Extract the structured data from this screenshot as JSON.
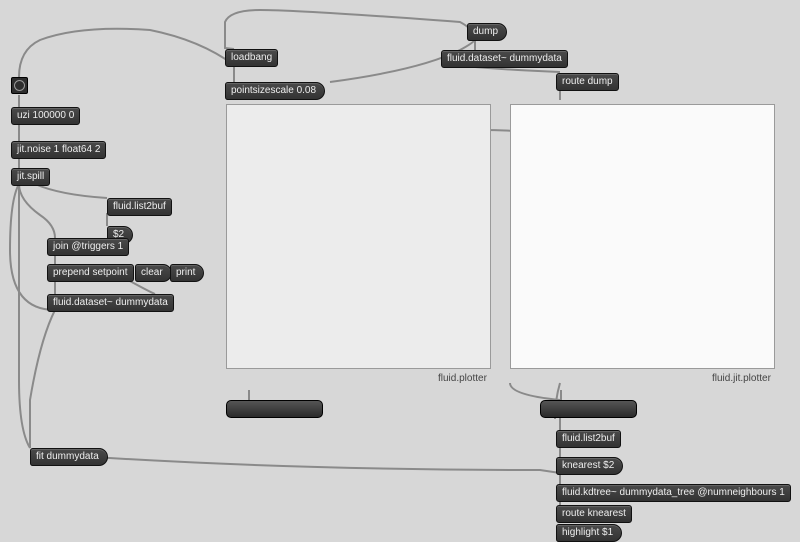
{
  "objects": {
    "uzi": "uzi 100000 0",
    "jitnoise": "jit.noise 1 float64 2",
    "jitspill": "jit.spill",
    "list2buf1": "fluid.list2buf",
    "dollar2a": "$2",
    "join": "join @triggers 1",
    "prepend": "prepend setpoint",
    "clear": "clear",
    "print": "print",
    "dataset1": "fluid.dataset~ dummydata",
    "fitdummy": "fit dummydata",
    "loadbang": "loadbang",
    "pointsize": "pointsizescale 0.08",
    "dump": "dump",
    "dataset2": "fluid.dataset~ dummydata",
    "routedump": "route dump",
    "list2buf2": "fluid.list2buf",
    "knearest": "knearest $2",
    "kdtree": "fluid.kdtree~ dummydata_tree @numneighbours 1",
    "routeknear": "route knearest",
    "highlight": "highlight $1"
  },
  "labels": {
    "plotter1": "fluid.plotter",
    "plotter2": "fluid.jit.plotter"
  }
}
